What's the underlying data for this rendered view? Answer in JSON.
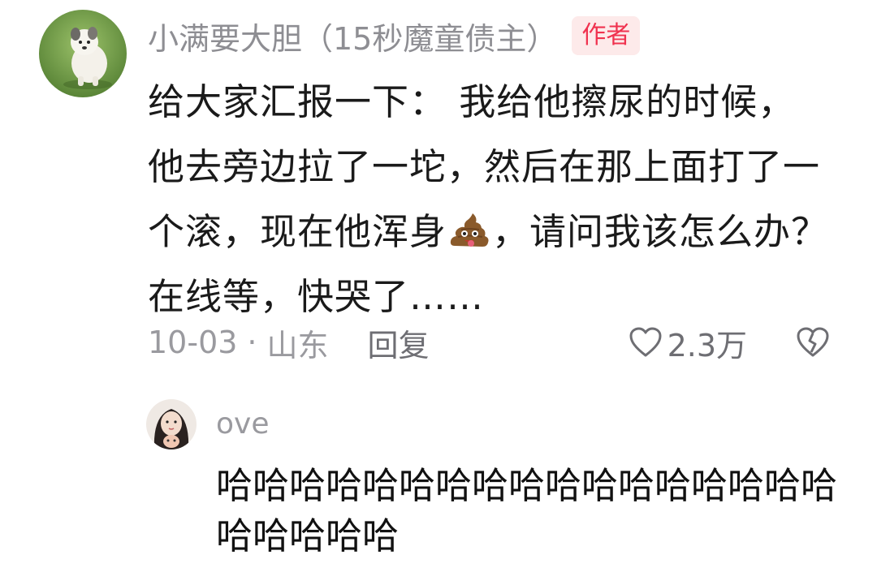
{
  "comment": {
    "author_name": "小满要大胆（15秒魔童债主）",
    "author_badge": "作者",
    "text_part1": "给大家汇报一下：  我给他擦尿的时候，他去旁边拉了一坨，然后在那上面打了一个滚，现在他浑身",
    "emoji": "poop-emoji",
    "text_part2": "，请问我该怎么办？ 在线等，快哭了……",
    "date": "10-03",
    "location": "山东",
    "reply_label": "回复",
    "like_count": "2.3万"
  },
  "reply": {
    "author_name": "ove",
    "text": "哈哈哈哈哈哈哈哈哈哈哈哈哈哈哈哈哈哈哈哈哈哈"
  },
  "icons": {
    "like": "heart-outline-icon",
    "dislike": "broken-heart-icon"
  },
  "colors": {
    "badge_text": "#f0324f",
    "badge_bg": "#fdeaea",
    "meta_gray": "#9a9a9f"
  }
}
